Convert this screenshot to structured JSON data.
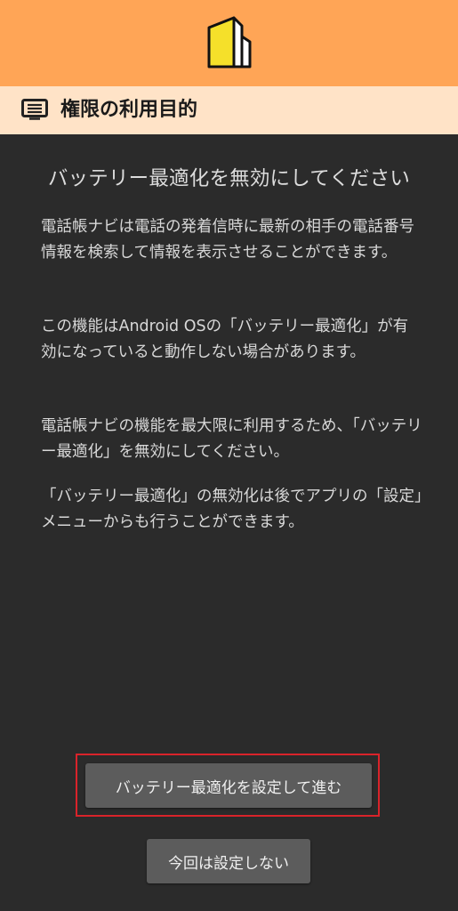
{
  "colors": {
    "top_bar": "#ffa556",
    "section_header_bg": "#ffe3c7",
    "background": "#2b2b2b",
    "button": "#5c5c5c",
    "highlight_border": "#d9232a",
    "logo_yellow": "#f5e02a"
  },
  "header": {
    "logo_icon": "building-logo-icon",
    "section_icon": "document-list-icon",
    "section_title": "権限の利用目的"
  },
  "main": {
    "title": "バッテリー最適化を無効にしてください",
    "paragraphs": [
      "電話帳ナビは電話の発着信時に最新の相手の電話番号情報を検索して情報を表示させることができます。",
      "この機能はAndroid OSの「バッテリー最適化」が有効になっていると動作しない場合があります。",
      "電話帳ナビの機能を最大限に利用するため、「バッテリー最適化」を無効にしてください。",
      "「バッテリー最適化」の無効化は後でアプリの「設定」メニューからも行うことができます。"
    ]
  },
  "buttons": {
    "primary_label": "バッテリー最適化を設定して進む",
    "secondary_label": "今回は設定しない"
  }
}
